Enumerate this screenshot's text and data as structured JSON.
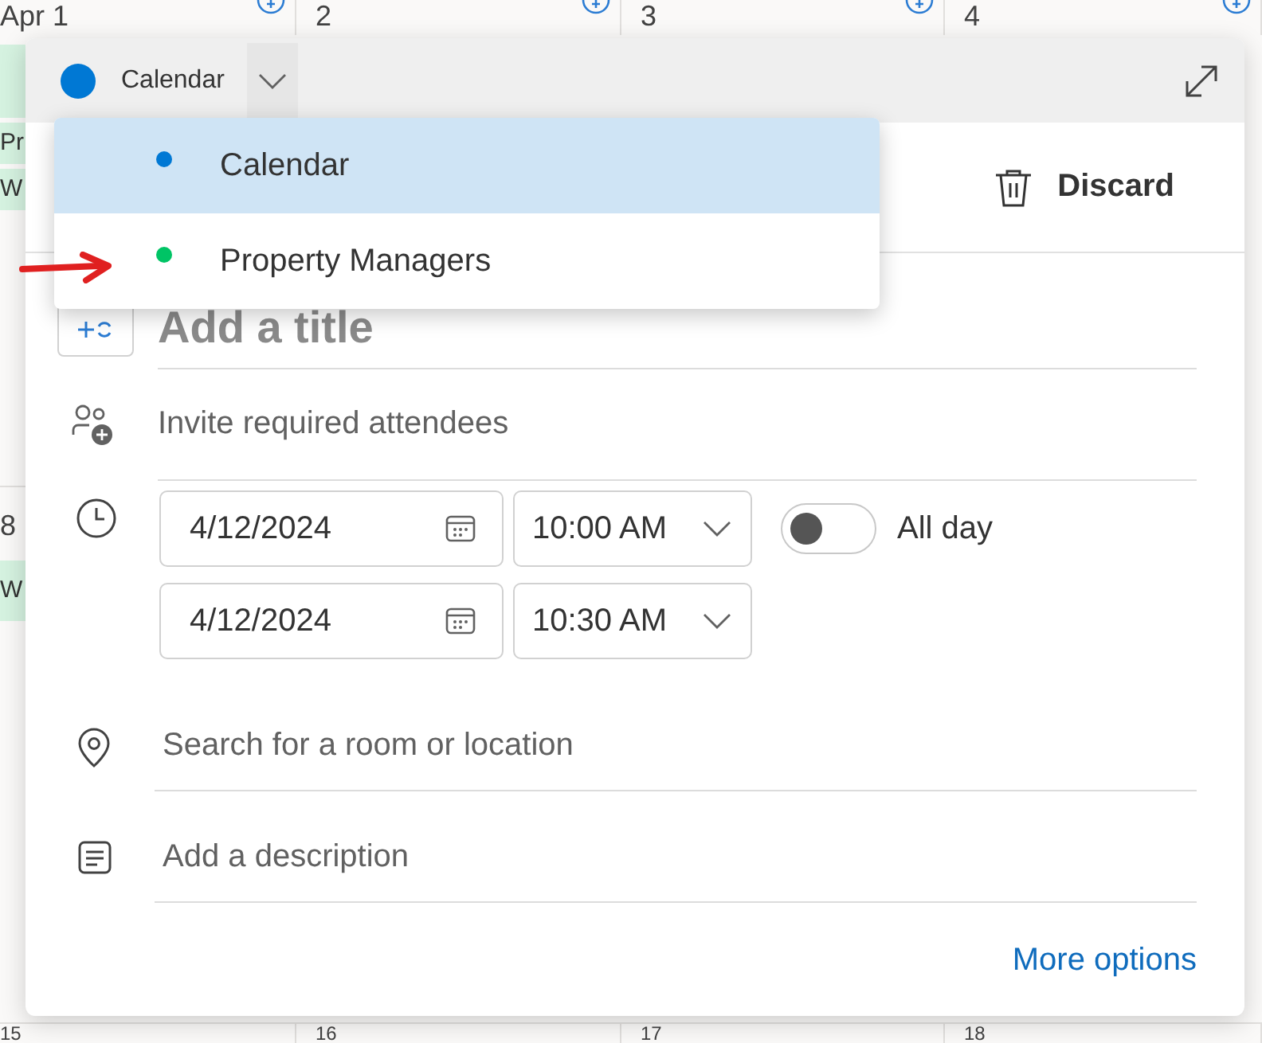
{
  "calendar": {
    "top_days": [
      {
        "label": "Apr 1"
      },
      {
        "label": "2"
      },
      {
        "label": "3"
      },
      {
        "label": "4"
      }
    ],
    "events": [
      {
        "label": "Pr"
      },
      {
        "label": "W"
      }
    ],
    "row_day": "8",
    "lower_events": [
      {
        "label": "W"
      }
    ],
    "bottom_days": [
      {
        "label": "15"
      },
      {
        "label": "16"
      },
      {
        "label": "17"
      },
      {
        "label": "18"
      }
    ]
  },
  "popup": {
    "calendar_picker": {
      "label": "Calendar",
      "color": "#0078d4"
    },
    "menu": [
      {
        "label": "Calendar",
        "color": "#0078d4",
        "selected": true,
        "pointer_arrow": false
      },
      {
        "label": "Property Managers",
        "color": "#00c465",
        "selected": false,
        "pointer_arrow": true
      }
    ],
    "discard": "Discard",
    "title_placeholder": "Add a title",
    "attendees_placeholder": "Invite required attendees",
    "start": {
      "date": "4/12/2024",
      "time": "10:00 AM"
    },
    "end": {
      "date": "4/12/2024",
      "time": "10:30 AM"
    },
    "all_day": {
      "label": "All day",
      "on": false
    },
    "location_placeholder": "Search for a room or location",
    "description_placeholder": "Add a description",
    "more_options": "More options"
  }
}
